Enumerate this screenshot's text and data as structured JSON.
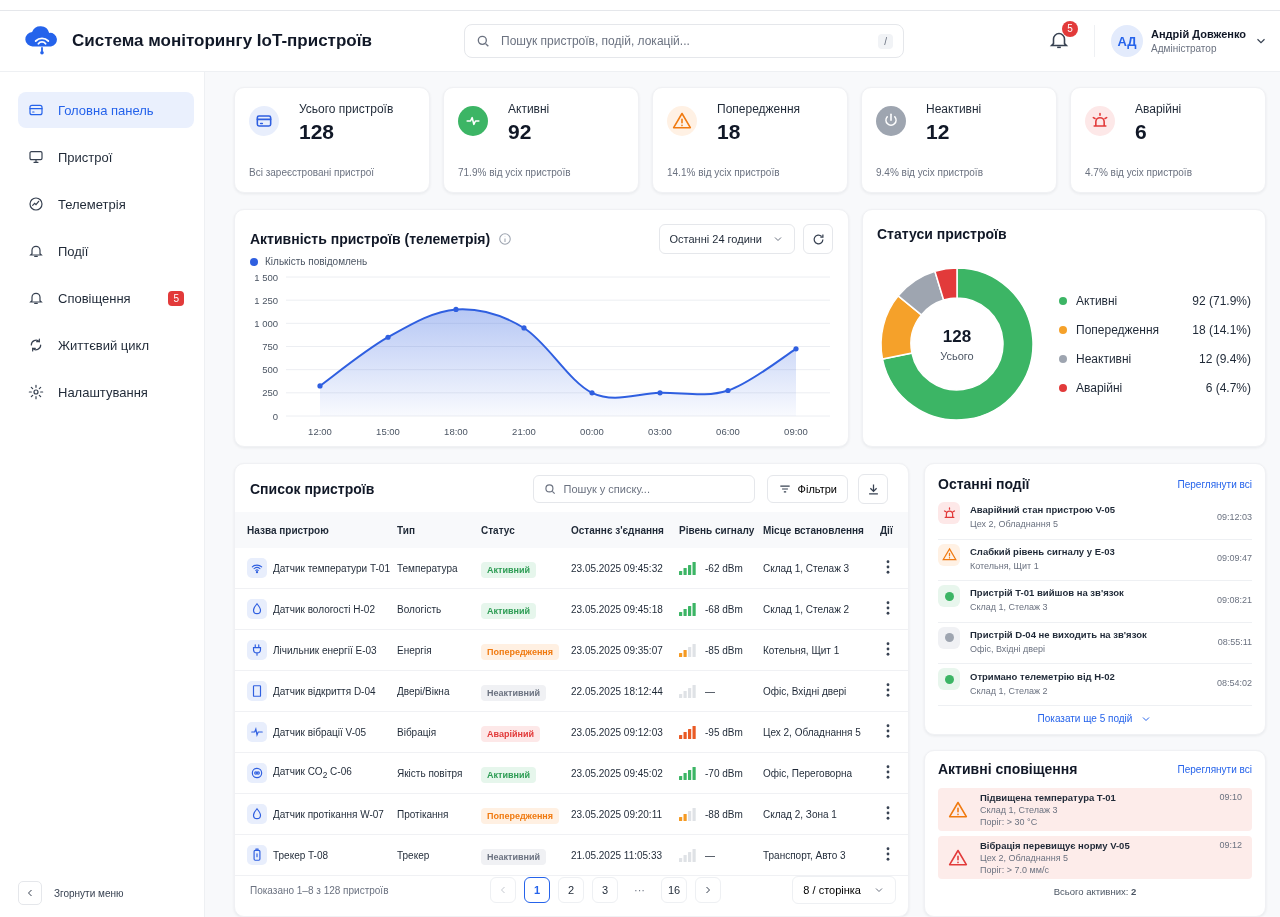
{
  "header": {
    "title": "Система моніторингу IoT-пристроїв",
    "search": {
      "placeholder": "Пошук пристроїв, подій, локацій...",
      "shortcut": "/"
    },
    "notifications_badge": "5",
    "user": {
      "initials": "АД",
      "name": "Андрій Довженко",
      "role": "Адміністратор"
    }
  },
  "sidebar": {
    "items": [
      {
        "label": "Головна панель",
        "selected": true
      },
      {
        "label": "Пристрої",
        "selected": false
      },
      {
        "label": "Телеметрія",
        "selected": false
      },
      {
        "label": "Події",
        "selected": false
      },
      {
        "label": "Сповіщення",
        "selected": false,
        "badge": "5"
      },
      {
        "label": "Життєвий цикл",
        "selected": false
      },
      {
        "label": "Налаштування",
        "selected": false
      }
    ],
    "collapse": "Згорнути меню"
  },
  "stats": [
    {
      "kind": "total",
      "label": "Усього пристроїв",
      "value": "128",
      "note": "Всі зареєстровані пристрої"
    },
    {
      "kind": "active",
      "label": "Активні",
      "value": "92",
      "note": "71.9% від усіх пристроїв"
    },
    {
      "kind": "warning",
      "label": "Попередження",
      "value": "18",
      "note": "14.1% від усіх пристроїв"
    },
    {
      "kind": "inactive",
      "label": "Неактивні",
      "value": "12",
      "note": "9.4% від усіх пристроїв"
    },
    {
      "kind": "alarm",
      "label": "Аварійні",
      "value": "6",
      "note": "4.7% від усіх пристроїв"
    }
  ],
  "activity": {
    "title": "Активність пристроїв (телеметрія)",
    "range": "Останні 24 години",
    "chart_data": {
      "type": "area",
      "categories": [
        "12:00",
        "15:00",
        "18:00",
        "21:00",
        "00:00",
        "03:00",
        "06:00",
        "09:00"
      ],
      "series": [
        {
          "name": "Кількість повідомлень",
          "color": "#2f5fe0",
          "values": [
            325,
            850,
            1150,
            950,
            250,
            250,
            275,
            725
          ]
        }
      ],
      "ylim": [
        0,
        1500
      ],
      "grid": true,
      "yticks": [
        {
          "value": 0,
          "label": "0"
        },
        {
          "value": 250,
          "label": "250"
        },
        {
          "value": 500,
          "label": "500"
        },
        {
          "value": 750,
          "label": "750"
        },
        {
          "value": 1000,
          "label": "1 000"
        },
        {
          "value": 1250,
          "label": "1 250"
        },
        {
          "value": 1500,
          "label": "1 500"
        }
      ]
    }
  },
  "statuses": {
    "title": "Статуси пристроїв",
    "center_value": "128",
    "center_label": "Усього",
    "chart_data": {
      "type": "donut",
      "categories": [
        "Активні",
        "Попередження",
        "Неактивні",
        "Аварійні"
      ],
      "values": [
        71.9,
        14.1,
        9.4,
        4.7
      ],
      "colors": [
        "#3cb565",
        "#f5a12a",
        "#9ea5b0",
        "#e23a3a"
      ],
      "value_labels": [
        "92 (71.9%)",
        "18 (14.1%)",
        "12 (9.4%)",
        "6 (4.7%)"
      ]
    }
  },
  "devices": {
    "title": "Список пристроїв",
    "search_placeholder": "Пошук у списку...",
    "filters": "Фільтри",
    "columns": [
      "Назва пристрою",
      "Тип",
      "Статус",
      "Останнє з'єднання",
      "Рівень сигналу",
      "Місце встановлення",
      "Дії"
    ],
    "rows": [
      {
        "name": "Датчик температури T-01",
        "type": "Температура",
        "kind": "active",
        "status_text": "Активний",
        "last_seen": "23.05.2025 09:45:32",
        "signal": "-62 dBm",
        "location": "Склад 1, Стелаж 3"
      },
      {
        "name": "Датчик вологості H-02",
        "type": "Вологість",
        "kind": "active",
        "status_text": "Активний",
        "last_seen": "23.05.2025 09:45:18",
        "signal": "-68 dBm",
        "location": "Склад 1, Стелаж 2"
      },
      {
        "name": "Лічильник енергії E-03",
        "type": "Енергія",
        "kind": "warning",
        "status_text": "Попередження",
        "last_seen": "23.05.2025 09:35:07",
        "signal": "-85 dBm",
        "location": "Котельня, Щит 1"
      },
      {
        "name": "Датчик відкриття D-04",
        "type": "Двері/Вікна",
        "kind": "inactive",
        "status_text": "Неактивний",
        "last_seen": "22.05.2025 18:12:44",
        "signal": "—",
        "location": "Офіс, Вхідні двері"
      },
      {
        "name": "Датчик вібрації V-05",
        "type": "Вібрація",
        "kind": "alarm",
        "status_text": "Аварійний",
        "last_seen": "23.05.2025 09:12:03",
        "signal": "-95 dBm",
        "location": "Цех 2, Обладнання 5"
      },
      {
        "name": "Датчик CO$_{2}$ C-06",
        "type": "Якість повітря",
        "kind": "active",
        "status_text": "Активний",
        "last_seen": "23.05.2025 09:45:02",
        "signal": "-70 dBm",
        "location": "Офіс, Переговорна"
      },
      {
        "name": "Датчик протікання W-07",
        "type": "Протікання",
        "kind": "warning",
        "status_text": "Попередження",
        "last_seen": "23.05.2025 09:20:11",
        "signal": "-88 dBm",
        "location": "Склад 2, Зона 1"
      },
      {
        "name": "Трекер T-08",
        "type": "Трекер",
        "kind": "inactive",
        "status_text": "Неактивний",
        "last_seen": "21.05.2025 11:05:33",
        "signal": "—",
        "location": "Транспорт, Авто 3"
      }
    ],
    "summary": "Показано 1–8 з 128 пристроїв",
    "pages": [
      {
        "kind": "page",
        "label": "1",
        "selected": true
      },
      {
        "kind": "page",
        "label": "2",
        "selected": false
      },
      {
        "kind": "page",
        "label": "3",
        "selected": false
      },
      {
        "kind": "ellipsis",
        "label": "···"
      },
      {
        "kind": "page",
        "label": "16",
        "selected": false
      }
    ],
    "prev_disabled": true,
    "per_page": "8 / сторінка"
  },
  "events": {
    "title": "Останні події",
    "view_all": "Переглянути всі",
    "items": [
      {
        "kind": "alarm",
        "title": "Аварійний стан пристрою V-05",
        "location": "Цех 2, Обладнання 5",
        "time": "09:12:03"
      },
      {
        "kind": "warning",
        "title": "Слабкий рівень сигналу у E-03",
        "location": "Котельня, Щит 1",
        "time": "09:09:47"
      },
      {
        "kind": "online",
        "title": "Пристрій T-01 вийшов на зв'язок",
        "location": "Склад 1, Стелаж 3",
        "time": "09:08:21"
      },
      {
        "kind": "offline",
        "title": "Пристрій D-04 не виходить на зв'язок",
        "location": "Офіс, Вхідні двері",
        "time": "08:55:11"
      },
      {
        "kind": "online",
        "title": "Отримано телеметрію від H-02",
        "location": "Склад 1, Стелаж 2",
        "time": "08:54:02"
      }
    ],
    "show_more": "Показати ще 5 подій"
  },
  "alerts": {
    "title": "Активні сповіщення",
    "view_all": "Переглянути всі",
    "items": [
      {
        "kind": "warning",
        "title": "Підвищена температура T-01",
        "location": "Склад 1, Стелаж 3",
        "threshold": "Поріг: > 30 °C",
        "time": "09:10"
      },
      {
        "kind": "alarm",
        "title": "Вібрація перевищує норму V-05",
        "location": "Цех 2, Обладнання 5",
        "threshold": "Поріг: > 7.0 мм/с",
        "time": "09:12"
      }
    ],
    "total": "Всього активних: **2**"
  }
}
